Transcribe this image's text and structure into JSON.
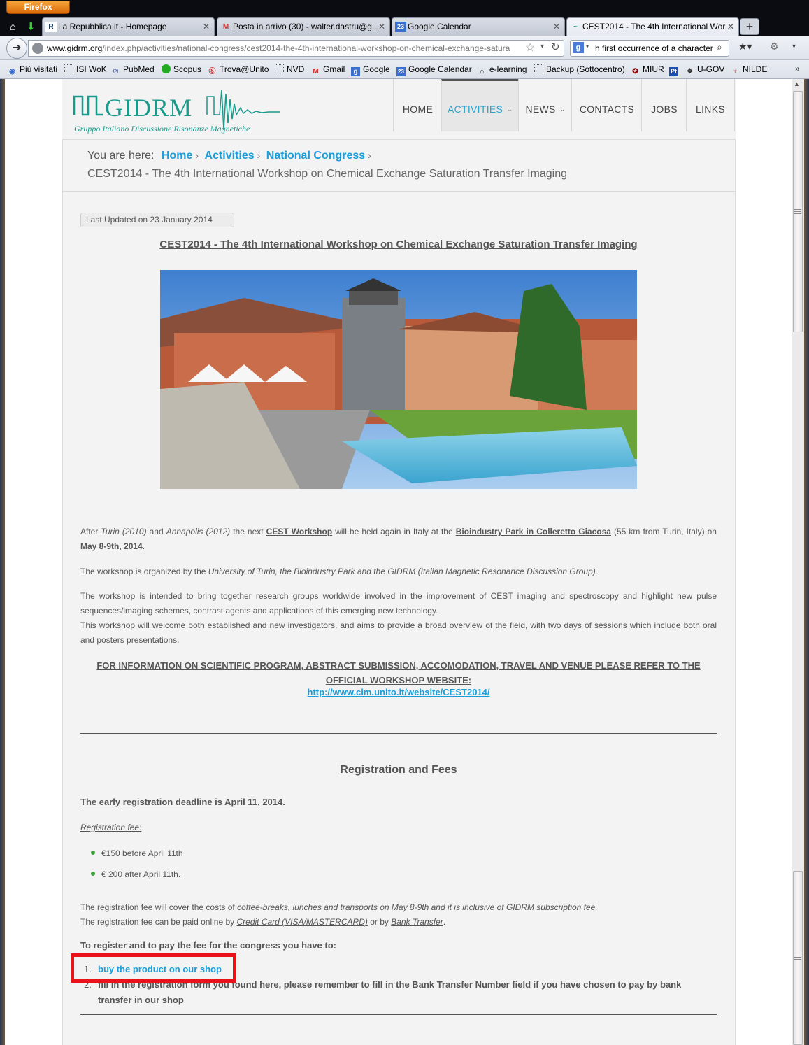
{
  "browser": {
    "menu_button": "Firefox",
    "tabs": [
      {
        "label": "La Repubblica.it - Homepage",
        "icon": "R"
      },
      {
        "label": "Posta in arrivo (30) - walter.dastru@g...",
        "icon": "M"
      },
      {
        "label": "Google Calendar",
        "icon": "23"
      },
      {
        "label": "CEST2014 - The 4th International Wor...",
        "icon": "~"
      }
    ],
    "url_host": "www.gidrm.org",
    "url_path": "/index.php/activities/national-congress/cest2014-the-4th-international-workshop-on-chemical-exchange-satura",
    "search_value": "h first occurrence of  a character",
    "bookmarks": [
      "Più visitati",
      "ISI WoK",
      "PubMed",
      "Scopus",
      "Trova@Unito",
      "NVD",
      "Gmail",
      "Google",
      "Google Calendar",
      "e-learning",
      "Backup (Sottocentro)",
      "MIUR",
      "U-GOV",
      "NILDE"
    ],
    "more": "»"
  },
  "site": {
    "logo_text": "GIDRM",
    "logo_subtitle": "Gruppo Italiano Discussione Risonanze Magnetiche",
    "menu": [
      "HOME",
      "ACTIVITIES",
      "NEWS",
      "CONTACTS",
      "JOBS",
      "LINKS"
    ]
  },
  "breadcrumb": {
    "prefix": "You are here:",
    "items": [
      "Home",
      "Activities",
      "National Congress"
    ],
    "current": "CEST2014 - The 4th International Workshop on Chemical Exchange Saturation Transfer Imaging"
  },
  "article": {
    "last_updated": "Last Updated on 23 January 2014",
    "title": "CEST2014 - The 4th International Workshop on Chemical Exchange Saturation Transfer Imaging",
    "p1": {
      "a": "After ",
      "b": "Turin (2010)",
      "c": " and ",
      "d": "Annapolis (2012)",
      "e": " the next ",
      "f": "CEST Workshop",
      "g": " will be held again in Italy at the ",
      "h": "Bioindustry Park in Colleretto Giacosa",
      "i": " (55 km from Turin, Italy) on ",
      "j": "May 8-9th, 2014",
      "k": "."
    },
    "p2": {
      "a": "The workshop is organized by the ",
      "b": "University of Turin, the Bioindustry Park and the GIDRM (Italian Magnetic Resonance Discussion Group)."
    },
    "p3": "The workshop is intended to bring together research groups worldwide involved in the improvement of CEST imaging and spectroscopy and highlight new pulse sequences/imaging schemes, contrast agents and applications of this emerging new technology.",
    "p4": "This workshop will welcome both established and new investigators, and aims to provide a broad overview of the field, with two days of sessions which include both oral and posters presentations.",
    "info_cta": "FOR INFORMATION ON SCIENTIFIC PROGRAM, ABSTRACT SUBMISSION, ACCOMODATION, TRAVEL AND VENUE PLEASE REFER TO THE OFFICIAL WORKSHOP WEBSITE:",
    "info_link": "http://www.cim.unito.it/website/CEST2014/",
    "registration_title": "Registration and Fees",
    "early_deadline": "The early registration deadline is April 11, 2014.",
    "fee_label": "Registration fee:",
    "fees": [
      "€150 before April 11th",
      "€ 200 after April 11th."
    ],
    "fee_cover": {
      "a": "The registration fee will cover the costs of ",
      "b": "coffee-breaks, lunches and transports on May 8-9th and it is inclusive of GIDRM subscription fee."
    },
    "fee_pay": {
      "a": "The registration fee can be paid online by ",
      "b": "Credit Card (VISA/MASTERCARD)",
      "c": " or by ",
      "d": "Bank Transfer",
      "e": "."
    },
    "to_register": "To register and to pay the fee for the congress you have to:",
    "steps": [
      {
        "num": "1.",
        "text": "buy the product on our shop"
      },
      {
        "num": "2.",
        "text": "fill in the registration form you found here, please remember to fill in the Bank Transfer Number field if you have chosen to pay by bank transfer in our shop"
      }
    ]
  },
  "colors": {
    "link": "#1a9dd9",
    "logo": "#1b9a8c",
    "highlight": "#e8141a"
  }
}
